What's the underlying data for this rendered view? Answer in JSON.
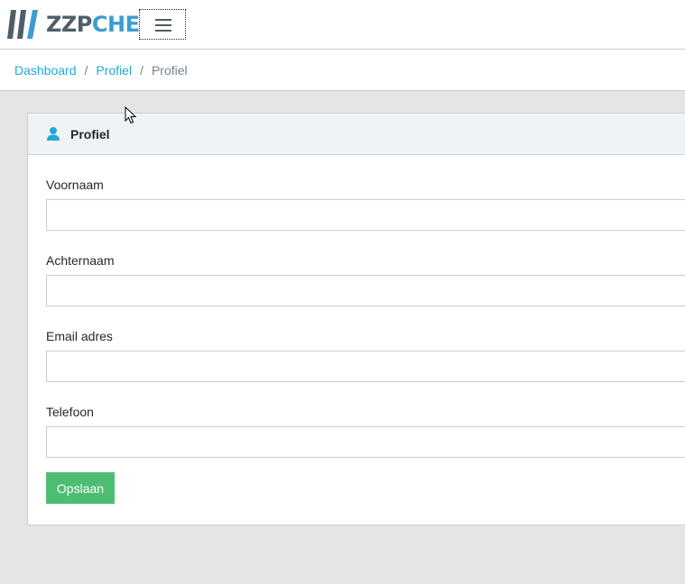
{
  "header": {
    "logo": {
      "text_zzp": "ZZP",
      "text_chef": "CHEF",
      "colors": {
        "zzp": "#4e5f6b",
        "chef": "#3a9dd2"
      }
    },
    "menu_toggle_icon": "hamburger-icon"
  },
  "breadcrumb": {
    "items": [
      {
        "label": "Dashboard",
        "link": true
      },
      {
        "label": "Profiel",
        "link": true
      },
      {
        "label": "Profiel",
        "link": false
      }
    ],
    "separator": "/"
  },
  "card": {
    "icon": "user-icon",
    "title": "Profiel",
    "fields": [
      {
        "label": "Voornaam",
        "value": "",
        "placeholder": ""
      },
      {
        "label": "Achternaam",
        "value": "",
        "placeholder": ""
      },
      {
        "label": "Email adres",
        "value": "",
        "placeholder": ""
      },
      {
        "label": "Telefoon",
        "value": "",
        "placeholder": ""
      }
    ],
    "save_label": "Opslaan"
  },
  "colors": {
    "accent": "#20a8d8",
    "success": "#4dbd74",
    "background": "#e4e5e6"
  }
}
